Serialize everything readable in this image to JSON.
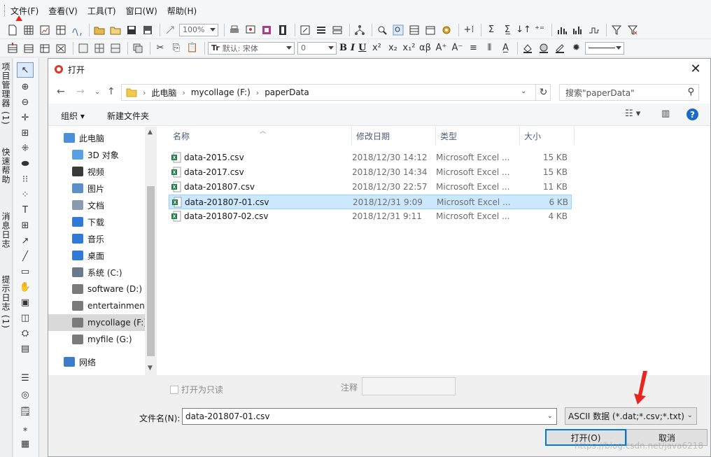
{
  "menubar": {
    "items": [
      "文件(F)",
      "查看(V)",
      "工具(T)",
      "窗口(W)",
      "帮助(H)"
    ]
  },
  "toolbar": {
    "zoom_value": "100%",
    "font_name": "默认: 宋体",
    "font_size": "0",
    "bold": "B",
    "italic": "I",
    "underline": "U"
  },
  "side_tabs": [
    "项目管理器 (1)",
    "快速帮助",
    "消息日志",
    "提示日志 (1)"
  ],
  "dialog": {
    "title": "打开",
    "breadcrumb": [
      "此电脑",
      "mycollage (F:)",
      "paperData"
    ],
    "search_placeholder": "搜索\"paperData\"",
    "organize_label": "组织 ▾",
    "new_folder_label": "新建文件夹",
    "tree": [
      {
        "label": "此电脑",
        "icon": "computer-icon",
        "color": "#4a90d9"
      },
      {
        "label": "3D 对象",
        "icon": "3d-objects-icon",
        "color": "#5aa0e0"
      },
      {
        "label": "视频",
        "icon": "video-icon",
        "color": "#3a3a3a"
      },
      {
        "label": "图片",
        "icon": "pictures-icon",
        "color": "#5b8fc9"
      },
      {
        "label": "文档",
        "icon": "documents-icon",
        "color": "#8a9bb0"
      },
      {
        "label": "下载",
        "icon": "download-icon",
        "color": "#2f7ad6"
      },
      {
        "label": "音乐",
        "icon": "music-icon",
        "color": "#2f7ad6"
      },
      {
        "label": "桌面",
        "icon": "desktop-icon",
        "color": "#2f7ad6"
      },
      {
        "label": "系统 (C:)",
        "icon": "system-drive-icon",
        "color": "#6a7a8c"
      },
      {
        "label": "software (D:)",
        "icon": "drive-icon",
        "color": "#7a7a7a"
      },
      {
        "label": "entertainment (E:)",
        "icon": "drive-icon",
        "color": "#7a7a7a"
      },
      {
        "label": "mycollage (F:)",
        "icon": "drive-icon",
        "color": "#7a7a7a"
      },
      {
        "label": "myfile (G:)",
        "icon": "drive-icon",
        "color": "#7a7a7a"
      },
      {
        "label": "网络",
        "icon": "network-icon",
        "color": "#3d7cc9"
      }
    ],
    "selected_tree_index": 11,
    "columns": [
      "名称",
      "修改日期",
      "类型",
      "大小"
    ],
    "files": [
      {
        "name": "data-2015.csv",
        "modified": "2018/12/30 14:12",
        "type": "Microsoft Excel ...",
        "size": "15 KB"
      },
      {
        "name": "data-2017.csv",
        "modified": "2018/12/30 14:34",
        "type": "Microsoft Excel ...",
        "size": "15 KB"
      },
      {
        "name": "data-201807.csv",
        "modified": "2018/12/30 22:57",
        "type": "Microsoft Excel ...",
        "size": "11 KB"
      },
      {
        "name": "data-201807-01.csv",
        "modified": "2018/12/31 9:09",
        "type": "Microsoft Excel ...",
        "size": "6 KB"
      },
      {
        "name": "data-201807-02.csv",
        "modified": "2018/12/31 9:11",
        "type": "Microsoft Excel ...",
        "size": "4 KB"
      }
    ],
    "selected_file_index": 3,
    "readonly_label": "打开为只读",
    "note_label": "注释",
    "filename_label": "文件名(N):",
    "filename_value": "data-201807-01.csv",
    "filetype_value": "ASCII 数据 (*.dat;*.csv;*.txt)",
    "open_label": "打开(O)",
    "cancel_label": "取消",
    "watermark": "https://blog.csdn.net/java6218"
  },
  "colors": {
    "accent": "#0078d7",
    "selection": "#cce8ff",
    "annotation_arrow": "#e8261f",
    "excel_green": "#1d7a45"
  }
}
